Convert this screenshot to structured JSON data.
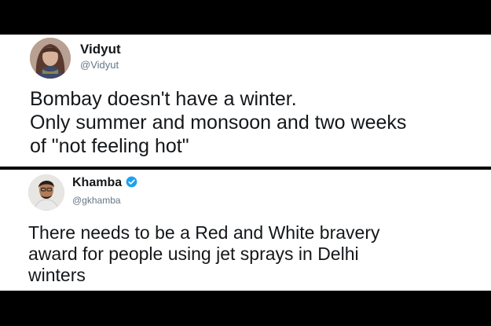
{
  "page": {
    "background_color": "#000000",
    "card_color": "#ffffff"
  },
  "tweets": [
    {
      "display_name": "Vidyut",
      "handle": "@Vidyut",
      "verified": false,
      "avatar_icon": "woman-portrait-avatar",
      "text": "Bombay doesn't have a winter.\nOnly summer and monsoon and two weeks\nof \"not feeling hot\""
    },
    {
      "display_name": "Khamba",
      "handle": "@gkhamba",
      "verified": true,
      "verified_icon": "verified-badge-icon",
      "verified_color": "#1da1f2",
      "avatar_icon": "man-portrait-avatar",
      "text": "There needs to be a Red and White bravery\naward for people using jet sprays in Delhi\nwinters"
    }
  ]
}
